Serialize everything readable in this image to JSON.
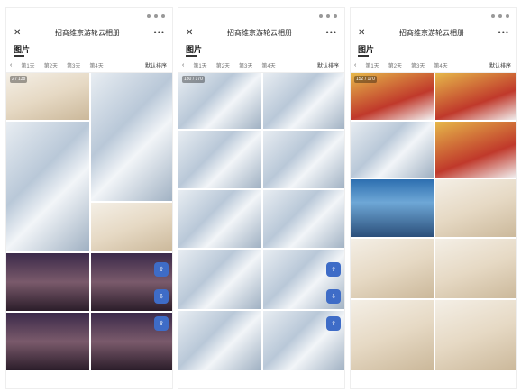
{
  "app": {
    "title": "招商维京游轮云相册",
    "close_icon": "close-icon",
    "more_icon": "more-icon"
  },
  "section_title": "图片",
  "tabs": [
    "第1天",
    "第2天",
    "第3天",
    "第4天"
  ],
  "sort_label": "默认排序",
  "phones": [
    {
      "counter": "2 / 138"
    },
    {
      "counter": "130 / 170"
    },
    {
      "counter": "152 / 170"
    }
  ],
  "fab": {
    "label": "上传"
  }
}
